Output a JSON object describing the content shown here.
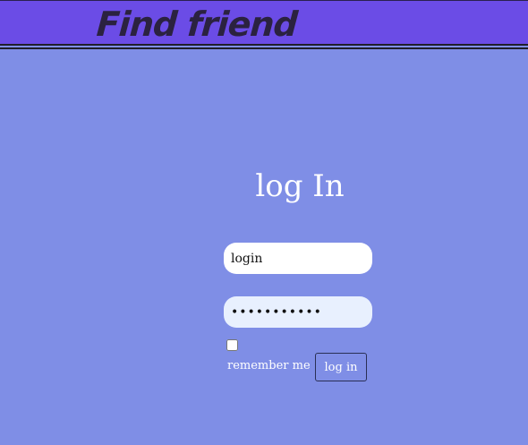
{
  "header": {
    "brand": "Find friend"
  },
  "form": {
    "title": "log In",
    "login_value": "login",
    "password_value": "•••••••••••",
    "remember_label": "remember me",
    "remember_checked": false,
    "submit_label": "log in"
  },
  "colors": {
    "page_background": "#7f8ee6",
    "header_background": "#6b4ce6",
    "brand_text": "#2b2240"
  }
}
